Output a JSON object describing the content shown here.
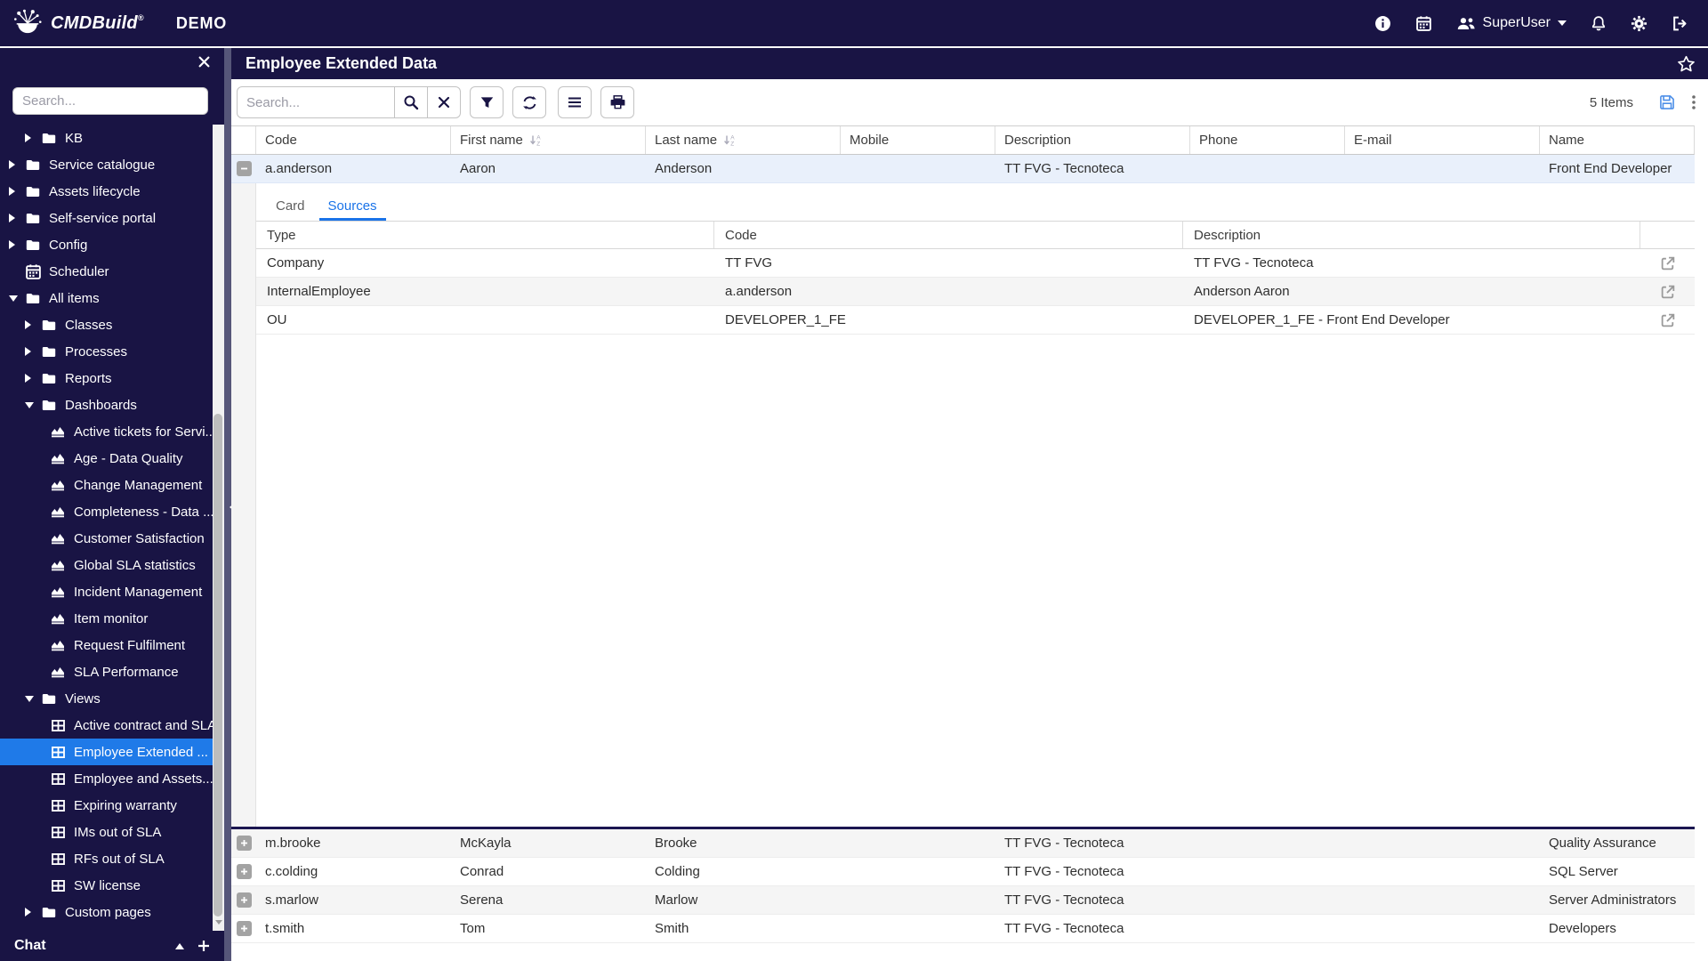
{
  "colors": {
    "navy": "#191444",
    "accent_blue": "#1a73e8",
    "selection_blue": "#1f7ae8",
    "save_icon_blue": "#4d8fe8",
    "selected_row_bg": "#e9f0fb"
  },
  "navbar": {
    "brand": "CMDBuild",
    "trademark": "®",
    "environment": "DEMO",
    "user": "SuperUser"
  },
  "sidebar": {
    "search_placeholder": "Search...",
    "chat_label": "Chat",
    "tree": [
      {
        "label": "KB",
        "level": 1,
        "icon": "folder",
        "caret": "right"
      },
      {
        "label": "Service catalogue",
        "level": 0,
        "icon": "folder",
        "caret": "right"
      },
      {
        "label": "Assets lifecycle",
        "level": 0,
        "icon": "folder",
        "caret": "right"
      },
      {
        "label": "Self-service portal",
        "level": 0,
        "icon": "folder",
        "caret": "right"
      },
      {
        "label": "Config",
        "level": 0,
        "icon": "folder",
        "caret": "right"
      },
      {
        "label": "Scheduler",
        "level": 0,
        "icon": "calendar",
        "caret": "none"
      },
      {
        "label": "All items",
        "level": 0,
        "icon": "folder",
        "caret": "down"
      },
      {
        "label": "Classes",
        "level": 1,
        "icon": "folder",
        "caret": "right"
      },
      {
        "label": "Processes",
        "level": 1,
        "icon": "folder",
        "caret": "right"
      },
      {
        "label": "Reports",
        "level": 1,
        "icon": "folder",
        "caret": "right"
      },
      {
        "label": "Dashboards",
        "level": 1,
        "icon": "folder",
        "caret": "down"
      },
      {
        "label": "Active tickets for Servi...",
        "level": 2,
        "icon": "chart",
        "caret": "none"
      },
      {
        "label": "Age - Data Quality",
        "level": 2,
        "icon": "chart",
        "caret": "none"
      },
      {
        "label": "Change Management",
        "level": 2,
        "icon": "chart",
        "caret": "none"
      },
      {
        "label": "Completeness - Data ...",
        "level": 2,
        "icon": "chart",
        "caret": "none"
      },
      {
        "label": "Customer Satisfaction",
        "level": 2,
        "icon": "chart",
        "caret": "none"
      },
      {
        "label": "Global SLA statistics",
        "level": 2,
        "icon": "chart",
        "caret": "none"
      },
      {
        "label": "Incident Management",
        "level": 2,
        "icon": "chart",
        "caret": "none"
      },
      {
        "label": "Item monitor",
        "level": 2,
        "icon": "chart",
        "caret": "none"
      },
      {
        "label": "Request Fulfilment",
        "level": 2,
        "icon": "chart",
        "caret": "none"
      },
      {
        "label": "SLA Performance",
        "level": 2,
        "icon": "chart",
        "caret": "none"
      },
      {
        "label": "Views",
        "level": 1,
        "icon": "folder",
        "caret": "down"
      },
      {
        "label": "Active contract and SLA",
        "level": 2,
        "icon": "view",
        "caret": "none"
      },
      {
        "label": "Employee Extended ...",
        "level": 2,
        "icon": "view",
        "caret": "none",
        "selected": true
      },
      {
        "label": "Employee and Assets...",
        "level": 2,
        "icon": "view",
        "caret": "none"
      },
      {
        "label": "Expiring warranty",
        "level": 2,
        "icon": "view",
        "caret": "none"
      },
      {
        "label": "IMs out of SLA",
        "level": 2,
        "icon": "view",
        "caret": "none"
      },
      {
        "label": "RFs out of SLA",
        "level": 2,
        "icon": "view",
        "caret": "none"
      },
      {
        "label": "SW license",
        "level": 2,
        "icon": "view",
        "caret": "none"
      },
      {
        "label": "Custom pages",
        "level": 1,
        "icon": "folder",
        "caret": "right"
      }
    ]
  },
  "panel": {
    "title": "Employee Extended Data",
    "toolbar": {
      "search_placeholder": "Search...",
      "items_count": "5 Items"
    },
    "grid": {
      "columns": [
        {
          "label": "Code",
          "sortable": false
        },
        {
          "label": "First name",
          "sortable": true
        },
        {
          "label": "Last name",
          "sortable": true
        },
        {
          "label": "Mobile",
          "sortable": false
        },
        {
          "label": "Description",
          "sortable": false
        },
        {
          "label": "Phone",
          "sortable": false
        },
        {
          "label": "E-mail",
          "sortable": false
        },
        {
          "label": "Name",
          "sortable": false
        }
      ],
      "selected_row": {
        "code": "a.anderson",
        "first_name": "Aaron",
        "last_name": "Anderson",
        "mobile": "",
        "description": "TT FVG - Tecnoteca",
        "phone": "",
        "email": "",
        "name": "Front End Developer"
      },
      "rows": [
        {
          "code": "m.brooke",
          "first_name": "McKayla",
          "last_name": "Brooke",
          "mobile": "",
          "description": "TT FVG - Tecnoteca",
          "phone": "",
          "email": "",
          "name": "Quality Assurance"
        },
        {
          "code": "c.colding",
          "first_name": "Conrad",
          "last_name": "Colding",
          "mobile": "",
          "description": "TT FVG - Tecnoteca",
          "phone": "",
          "email": "",
          "name": "SQL Server"
        },
        {
          "code": "s.marlow",
          "first_name": "Serena",
          "last_name": "Marlow",
          "mobile": "",
          "description": "TT FVG - Tecnoteca",
          "phone": "",
          "email": "",
          "name": "Server Administrators"
        },
        {
          "code": "t.smith",
          "first_name": "Tom",
          "last_name": "Smith",
          "mobile": "",
          "description": "TT FVG - Tecnoteca",
          "phone": "",
          "email": "",
          "name": "Developers"
        }
      ]
    },
    "detail": {
      "tabs": [
        {
          "label": "Card",
          "active": false
        },
        {
          "label": "Sources",
          "active": true
        }
      ],
      "columns": [
        "Type",
        "Code",
        "Description"
      ],
      "rows": [
        {
          "type": "Company",
          "code": "TT FVG",
          "description": "TT FVG - Tecnoteca"
        },
        {
          "type": "InternalEmployee",
          "code": "a.anderson",
          "description": "Anderson Aaron"
        },
        {
          "type": "OU",
          "code": "DEVELOPER_1_FE",
          "description": "DEVELOPER_1_FE - Front End Developer"
        }
      ]
    }
  },
  "icons": {
    "cmdbuild-logo-icon": "molecule",
    "info-icon": "ⓘ",
    "calendar-icon": "▦",
    "users-icon": "👥",
    "caret-down-icon": "▾",
    "bell-icon": "🔔",
    "gear-icon": "⚙",
    "sign-out-icon": "⇥",
    "close-icon": "✕",
    "search-icon": "🔍",
    "clear-icon": "✕",
    "filter-icon": "funnel",
    "refresh-icon": "⟳",
    "menu-icon": "≡",
    "print-icon": "🖨",
    "favorite-star-icon": "☆",
    "save-view-icon": "💾",
    "kebab-menu-icon": "⋮",
    "folder-icon": "📁",
    "chart-icon": "area-chart",
    "view-icon": "table-grid",
    "external-link-icon": "↗",
    "expand-icon": "+",
    "collapse-icon": "−",
    "sort-alpha-icon": "↓AZ",
    "chat-collapse-icon": "▴",
    "chat-add-icon": "+"
  }
}
